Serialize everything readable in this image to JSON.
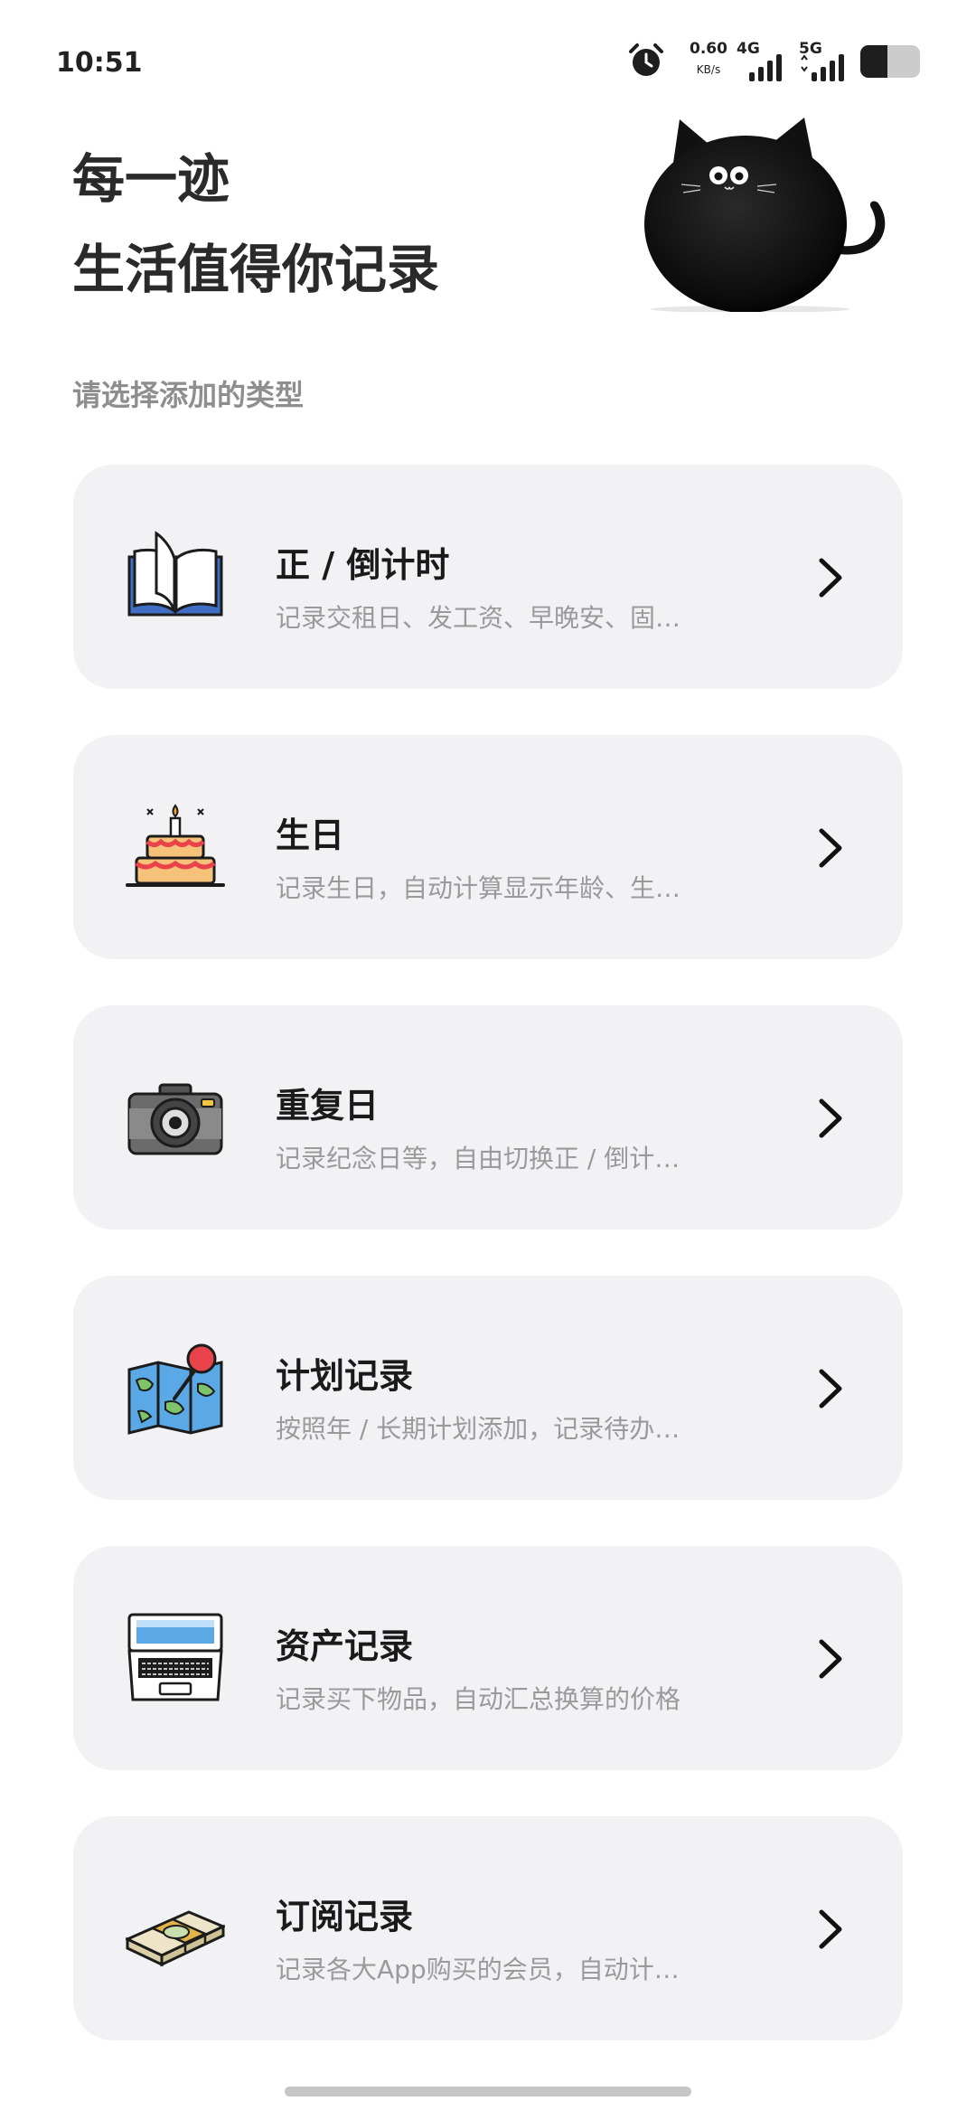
{
  "status_bar": {
    "time": "10:51",
    "net_speed_value": "0.60",
    "net_speed_unit": "KB/s",
    "signal_1_label": "4G",
    "signal_2_label": "5G",
    "battery_level": 0.45
  },
  "header": {
    "line1": "每一迹",
    "line2": "生活值得你记录"
  },
  "section_label": "请选择添加的类型",
  "cards": [
    {
      "title": "正 / 倒计时",
      "desc": "记录交租日、发工资、早晚安、固…",
      "icon": "open-book-icon"
    },
    {
      "title": "生日",
      "desc": "记录生日，自动计算显示年龄、生…",
      "icon": "birthday-cake-icon"
    },
    {
      "title": "重复日",
      "desc": "记录纪念日等，自由切换正 / 倒计…",
      "icon": "camera-icon"
    },
    {
      "title": "计划记录",
      "desc": "按照年 / 长期计划添加，记录待办…",
      "icon": "map-pin-icon"
    },
    {
      "title": "资产记录",
      "desc": "记录买下物品，自动汇总换算的价格",
      "icon": "laptop-icon"
    },
    {
      "title": "订阅记录",
      "desc": "记录各大App购买的会员，自动计…",
      "icon": "money-stack-icon"
    }
  ],
  "colors": {
    "card_bg": "#f2f2f5",
    "title_text": "#1a1a1a",
    "desc_text": "#9a9a9a",
    "section_label": "#8e8e8e"
  }
}
